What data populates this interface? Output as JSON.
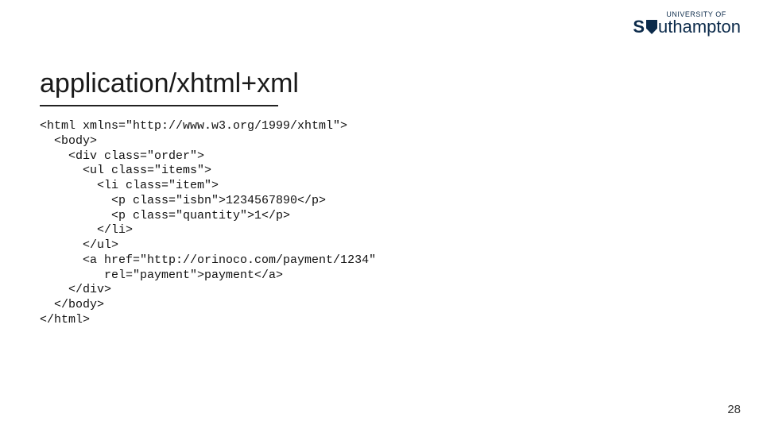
{
  "logo": {
    "top_text": "UNIVERSITY OF",
    "main_prefix": "S",
    "main_suffix": "uthampton"
  },
  "title": "application/xhtml+xml",
  "code": {
    "l01": "<html xmlns=\"http://www.w3.org/1999/xhtml\">",
    "l02": "  <body>",
    "l03": "    <div class=\"order\">",
    "l04": "      <ul class=\"items\">",
    "l05": "        <li class=\"item\">",
    "l06": "          <p class=\"isbn\">1234567890</p>",
    "l07": "          <p class=\"quantity\">1</p>",
    "l08": "        </li>",
    "l09": "      </ul>",
    "l10": "      <a href=\"http://orinoco.com/payment/1234\"",
    "l11": "         rel=\"payment\">payment</a>",
    "l12": "    </div>",
    "l13": "  </body>",
    "l14": "</html>"
  },
  "page_number": "28"
}
